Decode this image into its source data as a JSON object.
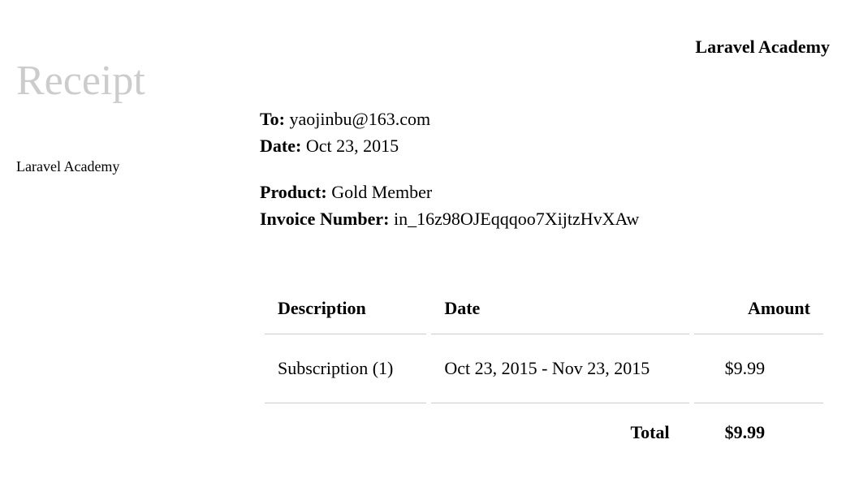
{
  "brand": "Laravel Academy",
  "heading": "Receipt",
  "vendor": "Laravel Academy",
  "meta": {
    "to_label": "To:",
    "to_value": "yaojinbu@163.com",
    "date_label": "Date:",
    "date_value": "Oct 23, 2015",
    "product_label": "Product:",
    "product_value": "Gold Member",
    "invoice_label": "Invoice Number:",
    "invoice_value": "in_16z98OJEqqqoo7XijtzHvXAw"
  },
  "table": {
    "headers": {
      "description": "Description",
      "date": "Date",
      "amount": "Amount"
    },
    "rows": [
      {
        "description": "Subscription (1)",
        "date": "Oct 23, 2015 - Nov 23, 2015",
        "amount": "$9.99"
      }
    ],
    "total_label": "Total",
    "total_value": "$9.99"
  }
}
